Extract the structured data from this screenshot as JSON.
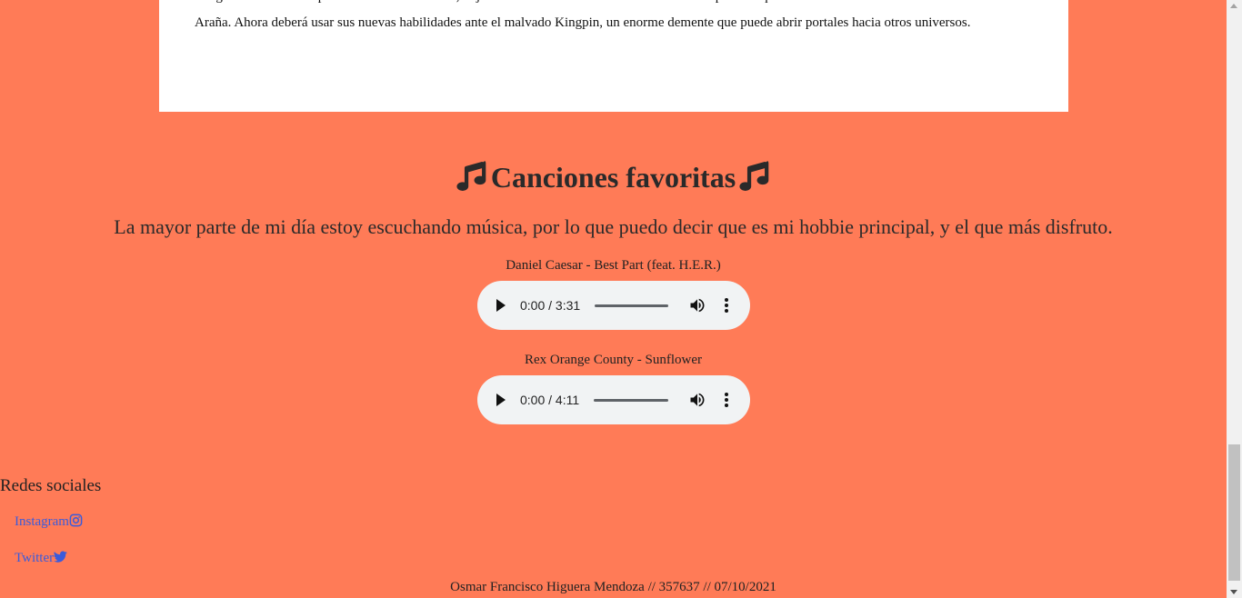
{
  "movie_card": {
    "line_partial": "Luego de ser mordido por una araña radioactiva, el joven Miles Morales desarrolla misteriosos poderes que lo transforman en el Hombre",
    "line_full": "Araña. Ahora deberá usar sus nuevas habilidades ante el malvado Kingpin, un enorme demente que puede abrir portales hacia otros universos."
  },
  "songs_section": {
    "title": "Canciones favoritas",
    "title_icon": "music-note-icon",
    "intro": "La mayor parte de mi día estoy escuchando música, por lo que puedo decir que es mi hobbie principal, y el que más disfruto."
  },
  "songs": [
    {
      "label": "Daniel Caesar - Best Part (feat. H.E.R.)",
      "time": "0:00 / 3:31",
      "progress": 0
    },
    {
      "label": "Rex Orange County - Sunflower",
      "time": "0:00 / 4:11",
      "progress": 0
    }
  ],
  "social": {
    "title": "Redes sociales",
    "links": [
      {
        "label": "Instagram",
        "icon": "instagram-icon"
      },
      {
        "label": "Twitter",
        "icon": "twitter-icon"
      }
    ]
  },
  "footer": {
    "text": "Osmar Francisco Higuera Mendoza // 357637 // 07/10/2021"
  },
  "colors": {
    "background": "#ff7b57",
    "card": "#ffffff",
    "link": "#3b5bdb",
    "player": "#f1f3f4"
  }
}
